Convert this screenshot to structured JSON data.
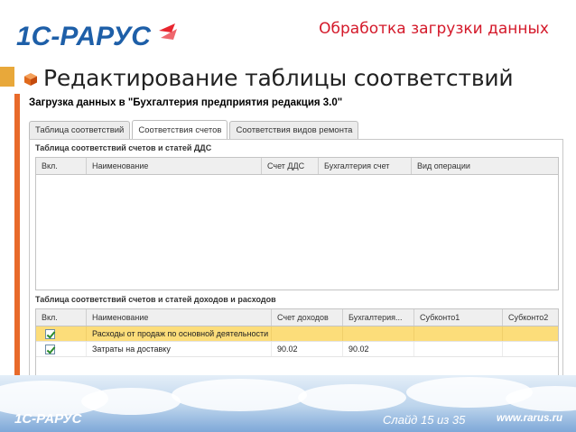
{
  "slide": {
    "header": "Обработка загрузки данных",
    "title": "Редактирование таблицы соответствий",
    "counter": "Слайд 15 из 35",
    "site": "www.rarus.ru",
    "logo_text": "1С-РАРУС"
  },
  "dialog": {
    "title": "Загрузка данных в \"Бухгалтерия предприятия редакция 3.0\"",
    "tabs": [
      {
        "label": "Таблица соответствий",
        "active": false
      },
      {
        "label": "Соответствия счетов",
        "active": true
      },
      {
        "label": "Соответствия видов ремонта",
        "active": false
      }
    ],
    "section1": {
      "label": "Таблица соответствий счетов и статей ДДС",
      "columns": [
        "Вкл.",
        "Наименование",
        "Счет ДДС",
        "Бухгалтерия счет",
        "Вид операции"
      ]
    },
    "section2": {
      "label": "Таблица соответствий счетов и статей доходов и расходов",
      "columns": [
        "Вкл.",
        "Наименование",
        "Счет доходов",
        "Бухгалтерия...",
        "Субконто1",
        "Субконто2"
      ],
      "rows": [
        {
          "checked": true,
          "name": "Расходы от продаж по основной деятельности",
          "income": "",
          "account": "",
          "sub1": "",
          "sub2": "",
          "selected": true
        },
        {
          "checked": true,
          "name": "Затраты на доставку",
          "income": "90.02",
          "account": "90.02",
          "sub1": "",
          "sub2": "",
          "selected": false
        }
      ]
    }
  },
  "colors": {
    "header_red": "#d4192a",
    "accent_orange": "#e86a2a",
    "selected_row": "#fcdd7a",
    "logo_blue": "#1e5fa8"
  }
}
